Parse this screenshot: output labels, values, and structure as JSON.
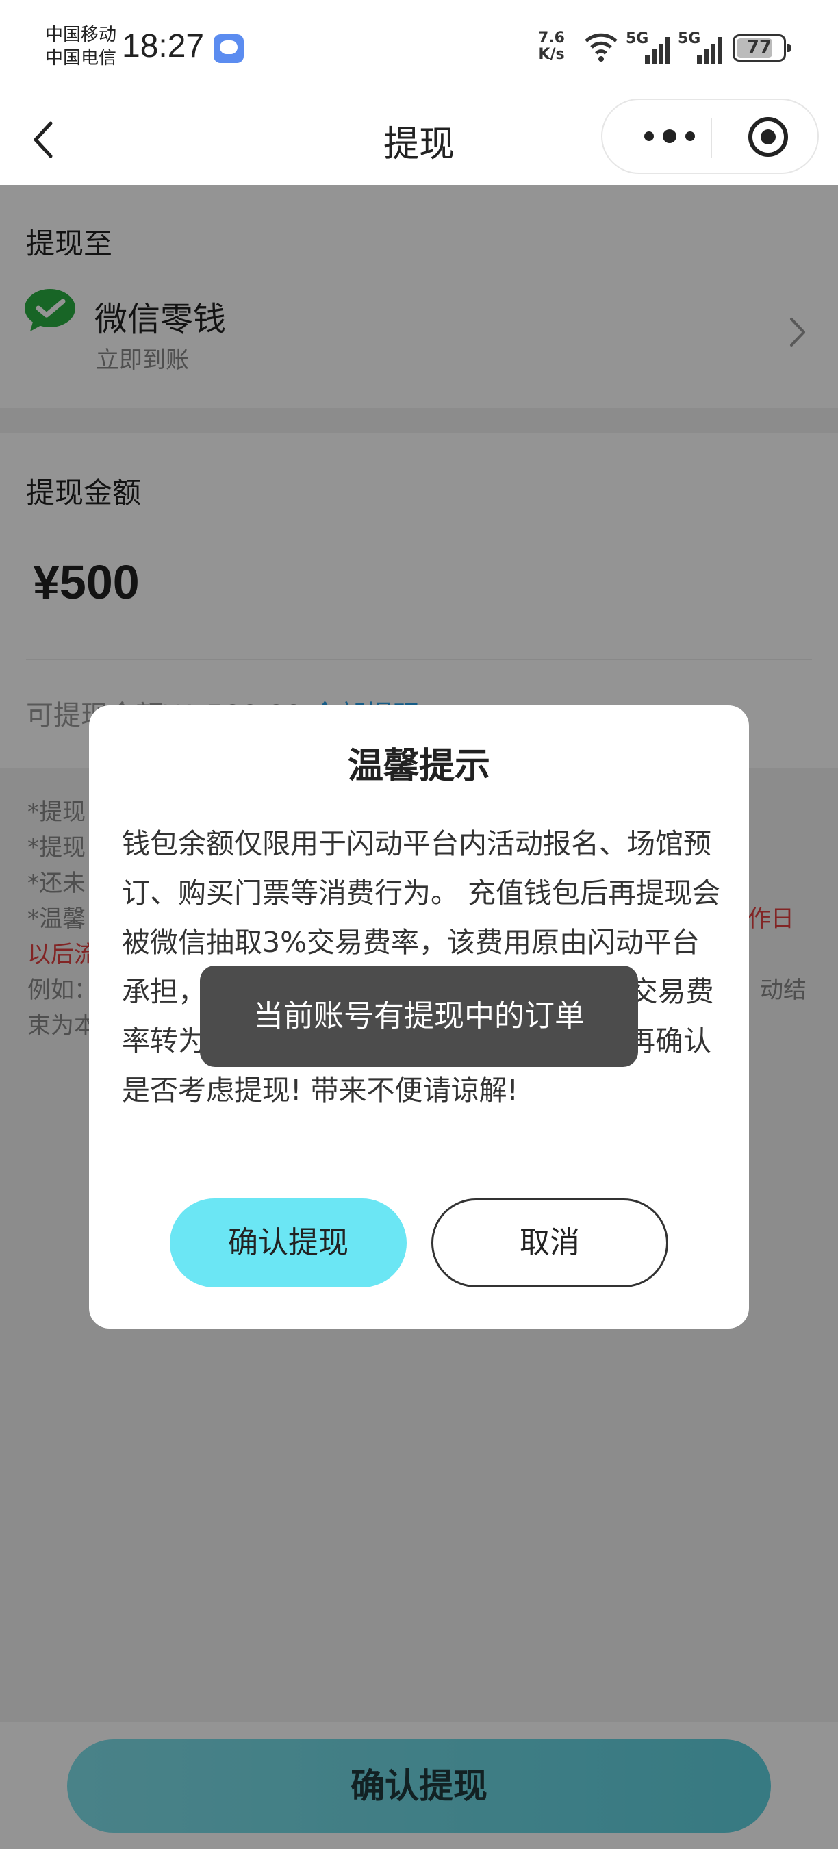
{
  "status_bar": {
    "carrier1": "中国移动",
    "carrier2": "中国电信",
    "time": "18:27",
    "net_speed_value": "7.6",
    "net_speed_unit": "K/s",
    "sig1_label": "5G",
    "sig2_label": "5G",
    "battery": "77"
  },
  "nav": {
    "title": "提现"
  },
  "withdraw_to": {
    "label": "提现至",
    "method": "微信零钱",
    "method_sub": "立即到账"
  },
  "amount_section": {
    "label": "提现金额",
    "amount": "¥500",
    "available_prefix": "可提现金额¥1,500.00",
    "available_link": "全部提现"
  },
  "notes": {
    "line1": "*提现",
    "line2": "*提现",
    "line3": "*还未",
    "line4_left": "*温馨",
    "line4_right": "作日",
    "line5": "以后流",
    "line6_left": "例如：",
    "line6_right": "动结",
    "line7": "束为本"
  },
  "dialog": {
    "title": "温馨提示",
    "body": "钱包余额仅限用于闪动平台内活动报名、场馆预订、购买门票等消费行为。 充值钱包后再提现会被微信抽取3%交易费率，该费用原由闪动平台承担，现平台于2022年11月22日起，将交易费率转为用户承担，请认真阅读该提示后，再确认是否考虑提现! 带来不便请谅解!",
    "confirm": "确认提现",
    "cancel": "取消"
  },
  "toast": {
    "text": "当前账号有提现中的订单"
  },
  "bottom": {
    "confirm_button": "确认提现"
  },
  "colors": {
    "accent_cyan": "#6be6f4",
    "link_blue": "#2aa0e8",
    "warning_red": "#e04040",
    "wechat_green": "#2aae42"
  }
}
